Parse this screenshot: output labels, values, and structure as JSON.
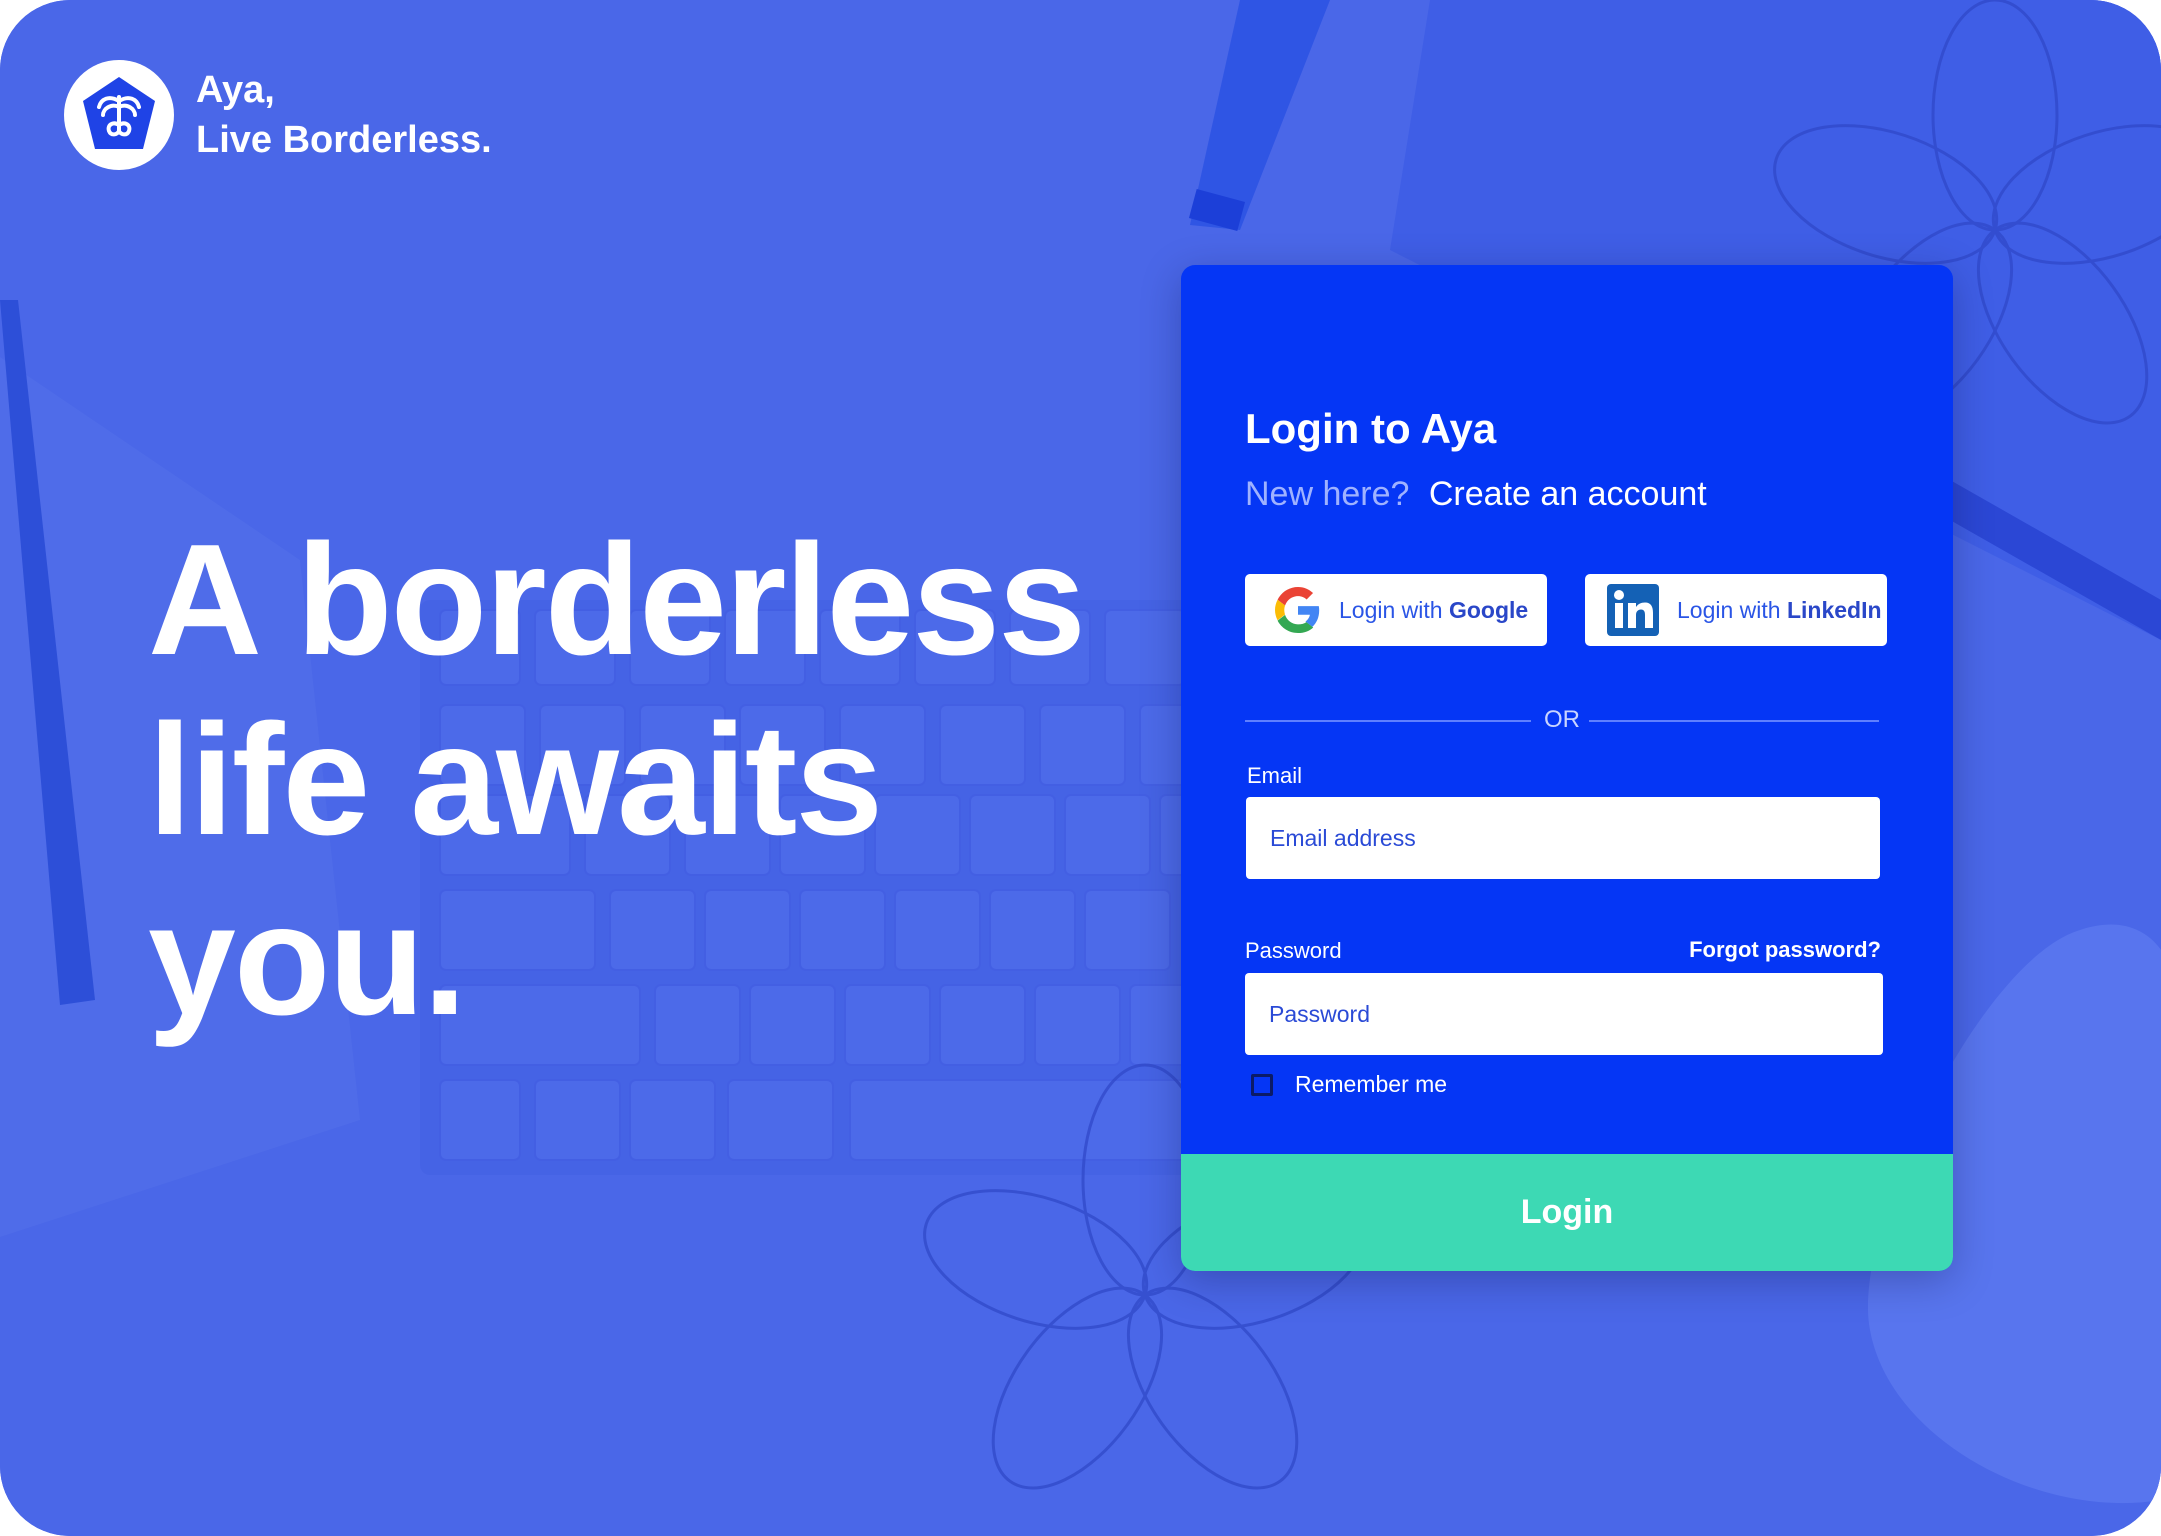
{
  "brand": {
    "line1": "Aya,",
    "line2": "Live Borderless.",
    "logo_icon": "aya-palm-logo-icon"
  },
  "hero": {
    "lines": [
      "A borderless",
      "life awaits",
      "you."
    ]
  },
  "login": {
    "title": "Login to Aya",
    "new_here": "New here?",
    "create_account": "Create an account",
    "google": {
      "prefix": "Login with ",
      "provider": "Google",
      "icon": "google-icon"
    },
    "linkedin": {
      "prefix": "Login with ",
      "provider": "LinkedIn",
      "icon": "linkedin-icon"
    },
    "divider": "OR",
    "email_label": "Email",
    "email_placeholder": "Email address",
    "email_value": "",
    "password_label": "Password",
    "forgot": "Forgot password?",
    "password_placeholder": "Password",
    "password_value": "",
    "remember": "Remember me",
    "remember_checked": false,
    "submit": "Login"
  },
  "colors": {
    "background": "#4a67e8",
    "card": "#0536f5",
    "accent_green": "#3dd9b4",
    "white": "#ffffff"
  }
}
